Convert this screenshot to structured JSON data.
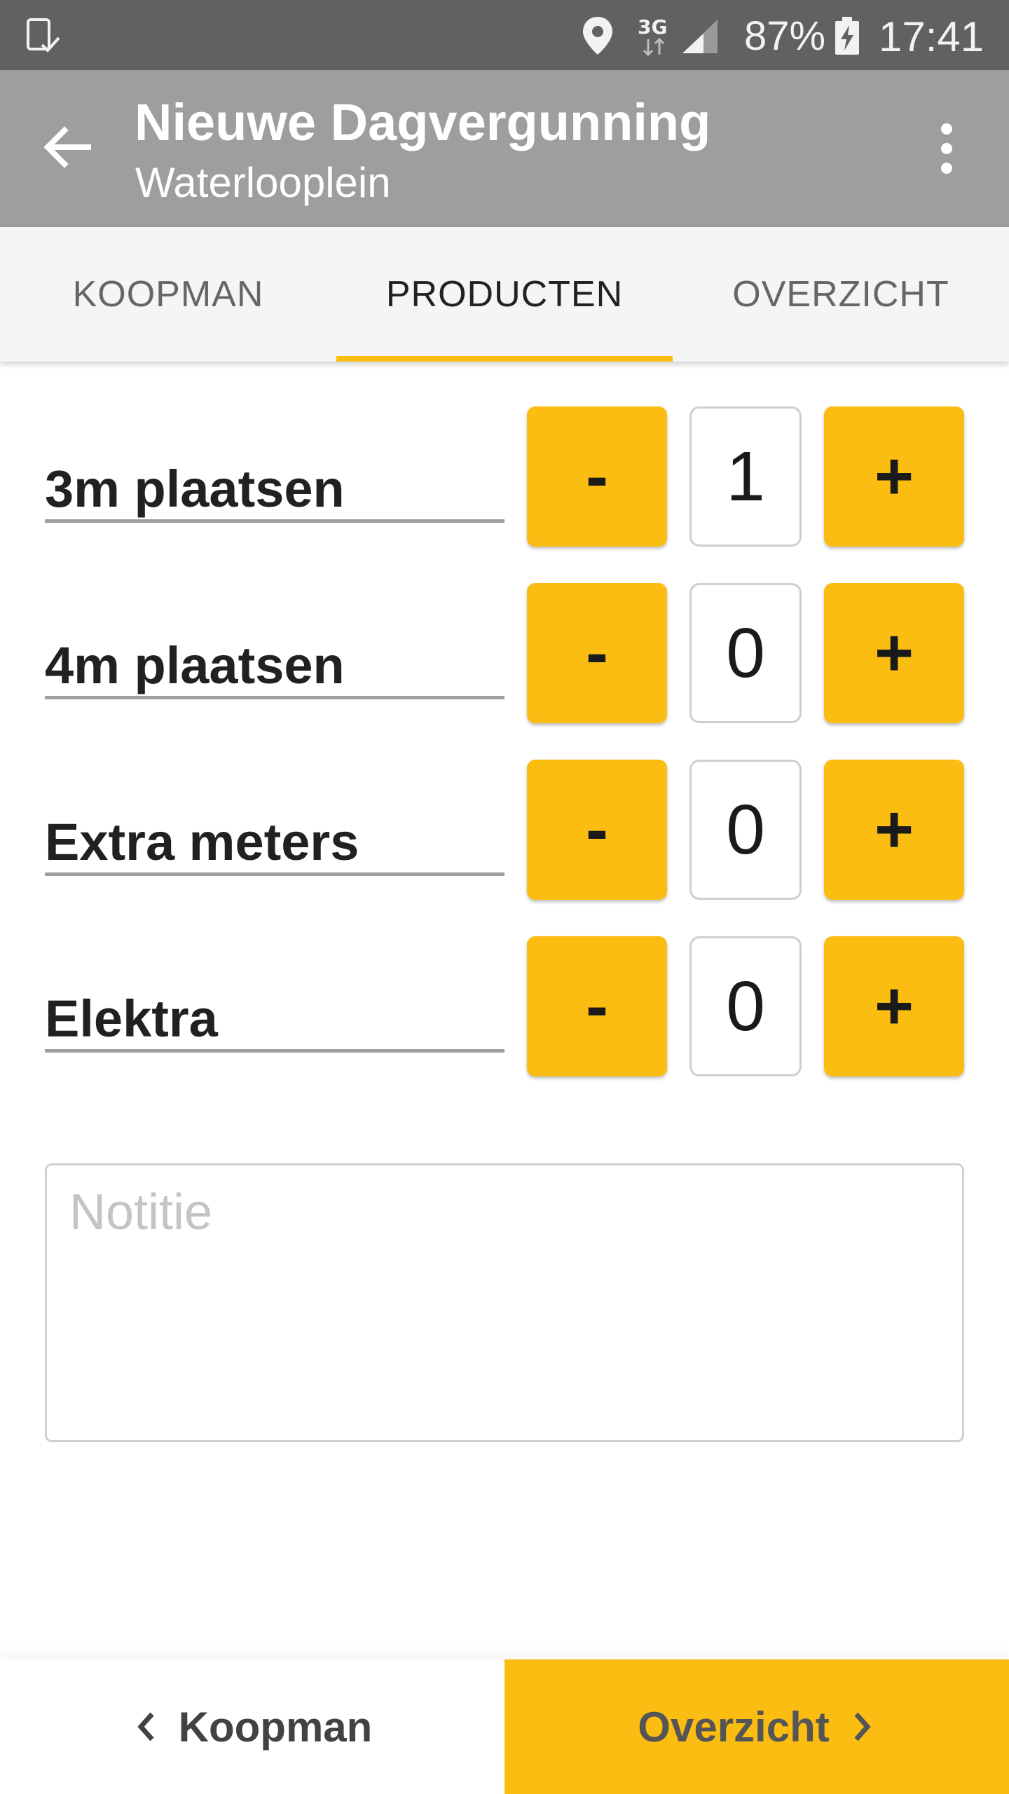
{
  "statusbar": {
    "network": "3G",
    "battery": "87%",
    "time": "17:41",
    "icons": [
      "screenshot-icon",
      "location-icon",
      "data-arrows-icon",
      "signal-icon",
      "battery-charging-icon"
    ]
  },
  "appbar": {
    "title": "Nieuwe Dagvergunning",
    "subtitle": "Waterlooplein",
    "back_icon": "arrow-left-icon",
    "menu_icon": "more-vert-icon"
  },
  "tabs": [
    {
      "label": "KOOPMAN",
      "active": false
    },
    {
      "label": "PRODUCTEN",
      "active": true
    },
    {
      "label": "OVERZICHT",
      "active": false
    }
  ],
  "products": [
    {
      "label": "3m plaatsen",
      "count": "1",
      "minus": "-",
      "plus": "+"
    },
    {
      "label": "4m plaatsen",
      "count": "0",
      "minus": "-",
      "plus": "+"
    },
    {
      "label": "Extra meters",
      "count": "0",
      "minus": "-",
      "plus": "+"
    },
    {
      "label": "Elektra",
      "count": "0",
      "minus": "-",
      "plus": "+"
    }
  ],
  "note": {
    "placeholder": "Notitie",
    "value": ""
  },
  "bottom": {
    "prev_label": "Koopman",
    "next_label": "Overzicht"
  },
  "colors": {
    "accent": "#fbbd12",
    "appbar": "#9e9e9e",
    "statusbar": "#616161"
  }
}
